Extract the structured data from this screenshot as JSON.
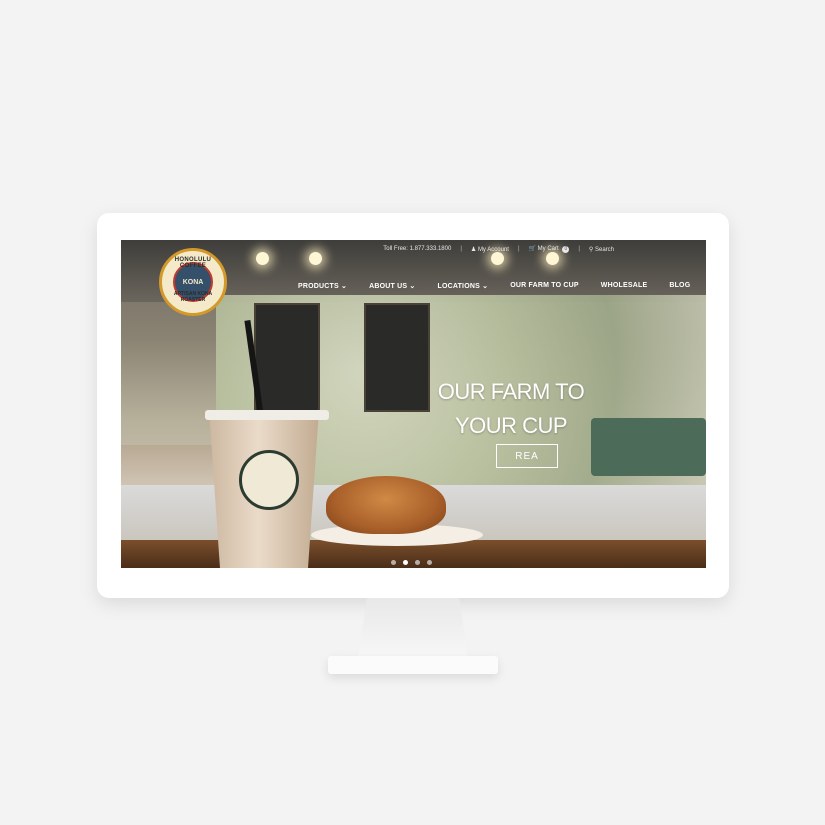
{
  "topbar": {
    "toll_free": "Toll Free: 1.877.333.1800",
    "account": "My Account",
    "cart": "My Cart",
    "cart_count": "0",
    "search": "Search"
  },
  "logo": {
    "ring_text": "HONOLULU COFFEE",
    "center_text": "KONA",
    "bottom_text": "ARTISAN KONA ROASTER"
  },
  "nav": {
    "items": [
      {
        "label": "PRODUCTS ⌄"
      },
      {
        "label": "ABOUT US ⌄"
      },
      {
        "label": "LOCATIONS ⌄"
      },
      {
        "label": "OUR FARM TO CUP"
      },
      {
        "label": "WHOLESALE"
      },
      {
        "label": "BLOG"
      }
    ]
  },
  "hero": {
    "title_line1": "OUR FARM TO",
    "title_line2": "YOUR CUP",
    "button_label": "REA"
  },
  "slider": {
    "count": 4,
    "active": 2
  },
  "icons": {
    "account": "user-icon",
    "cart": "cart-icon",
    "search": "search-icon"
  }
}
